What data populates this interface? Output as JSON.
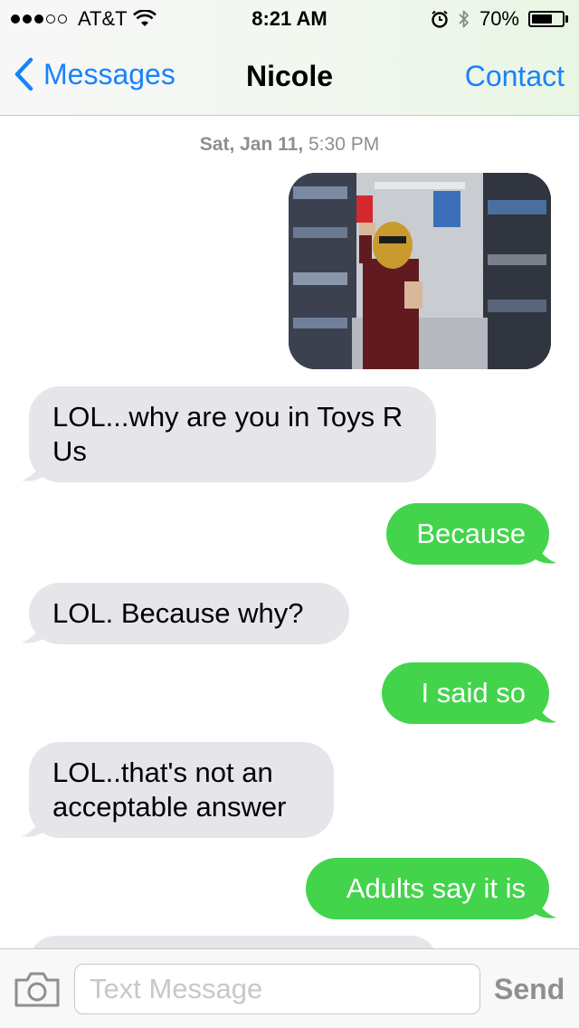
{
  "status_bar": {
    "carrier": "AT&T",
    "time": "8:21 AM",
    "battery_percent": "70%",
    "battery_level": 0.7,
    "signal_bars_filled": 3,
    "signal_bars_total": 5,
    "icons": [
      "wifi-icon",
      "alarm-icon",
      "bluetooth-icon",
      "battery-icon"
    ]
  },
  "nav": {
    "back_label": "Messages",
    "title": "Nicole",
    "contact_label": "Contact"
  },
  "conversation": {
    "timestamp_day": "Sat, Jan 11,",
    "timestamp_time": " 5:30 PM",
    "messages": [
      {
        "direction": "outgoing",
        "type": "photo",
        "text": ""
      },
      {
        "direction": "incoming",
        "type": "text",
        "text": "LOL...why are you in Toys R Us"
      },
      {
        "direction": "outgoing",
        "type": "text",
        "text": "Because"
      },
      {
        "direction": "incoming",
        "type": "text",
        "text": "LOL. Because why?"
      },
      {
        "direction": "outgoing",
        "type": "text",
        "text": "I said so"
      },
      {
        "direction": "incoming",
        "type": "text",
        "text": "LOL..that's not an acceptable answer"
      },
      {
        "direction": "outgoing",
        "type": "text",
        "text": "Adults say it is"
      }
    ]
  },
  "input_bar": {
    "placeholder": "Text Message",
    "send_label": "Send"
  },
  "colors": {
    "accent_blue": "#1a82fb",
    "outgoing_bubble": "#43d44c",
    "incoming_bubble": "#e5e5ea",
    "timestamp_gray": "#8e8e93"
  }
}
